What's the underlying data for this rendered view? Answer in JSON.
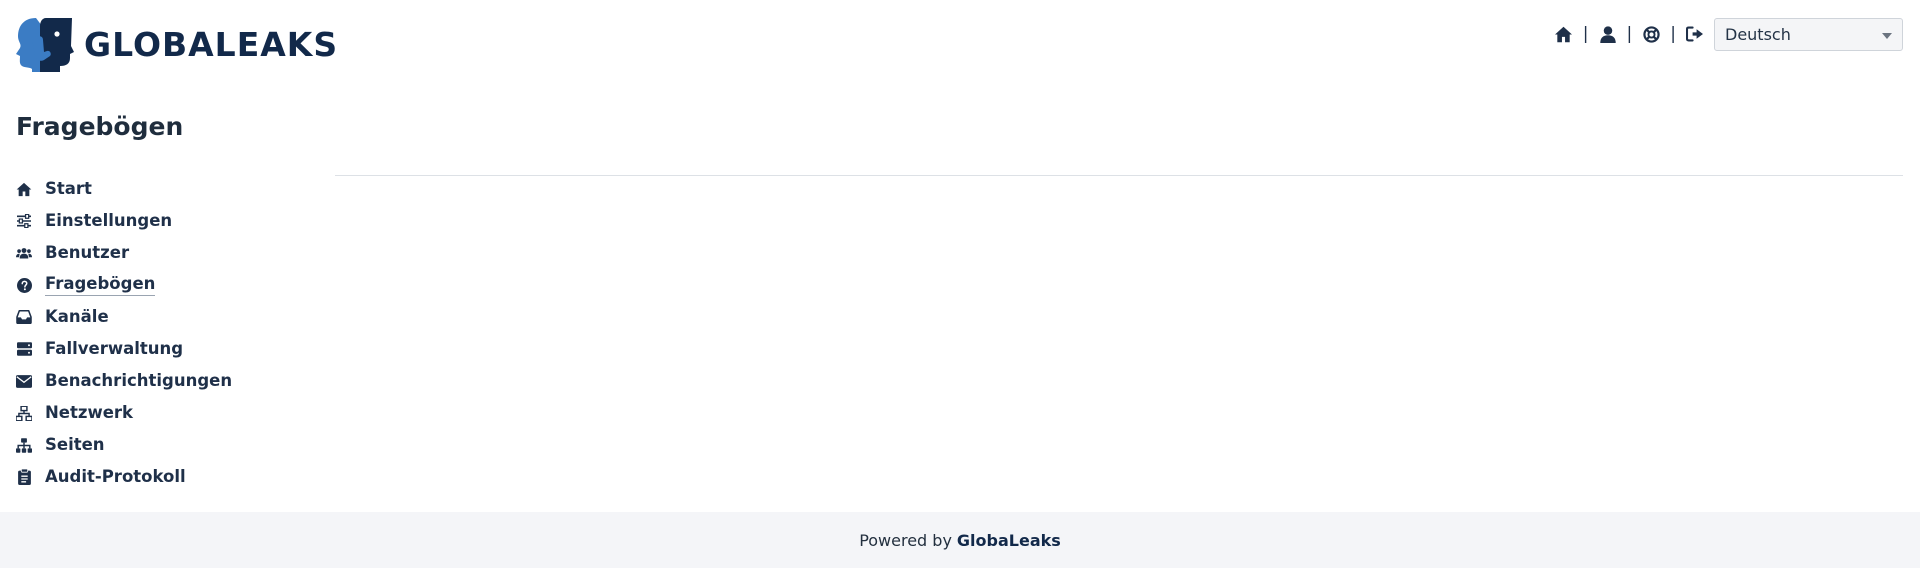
{
  "header": {
    "logo_text": "GLOBALEAKS",
    "nav_icons": [
      "home-icon",
      "user-icon",
      "lifebuoy-icon",
      "logout-icon"
    ],
    "separator": "|",
    "language": {
      "selected": "Deutsch"
    }
  },
  "page": {
    "title": "Fragebögen"
  },
  "sidebar": {
    "items": [
      {
        "label": "Start",
        "icon": "home-icon"
      },
      {
        "label": "Einstellungen",
        "icon": "sliders-icon"
      },
      {
        "label": "Benutzer",
        "icon": "users-icon"
      },
      {
        "label": "Fragebögen",
        "icon": "question-circle-icon",
        "active": true
      },
      {
        "label": "Kanäle",
        "icon": "inbox-icon"
      },
      {
        "label": "Fallverwaltung",
        "icon": "server-icon"
      },
      {
        "label": "Benachrichtigungen",
        "icon": "envelope-icon"
      },
      {
        "label": "Netzwerk",
        "icon": "network-icon"
      },
      {
        "label": "Seiten",
        "icon": "sitemap-icon"
      },
      {
        "label": "Audit-Protokoll",
        "icon": "clipboard-icon"
      }
    ]
  },
  "footer": {
    "prefix": "Powered by",
    "brand": "GlobaLeaks"
  },
  "colors": {
    "primary_text": "#1f3049",
    "logo_dark": "#12294a",
    "logo_blue": "#3b7cc4",
    "footer_bg": "#f4f5f8"
  }
}
